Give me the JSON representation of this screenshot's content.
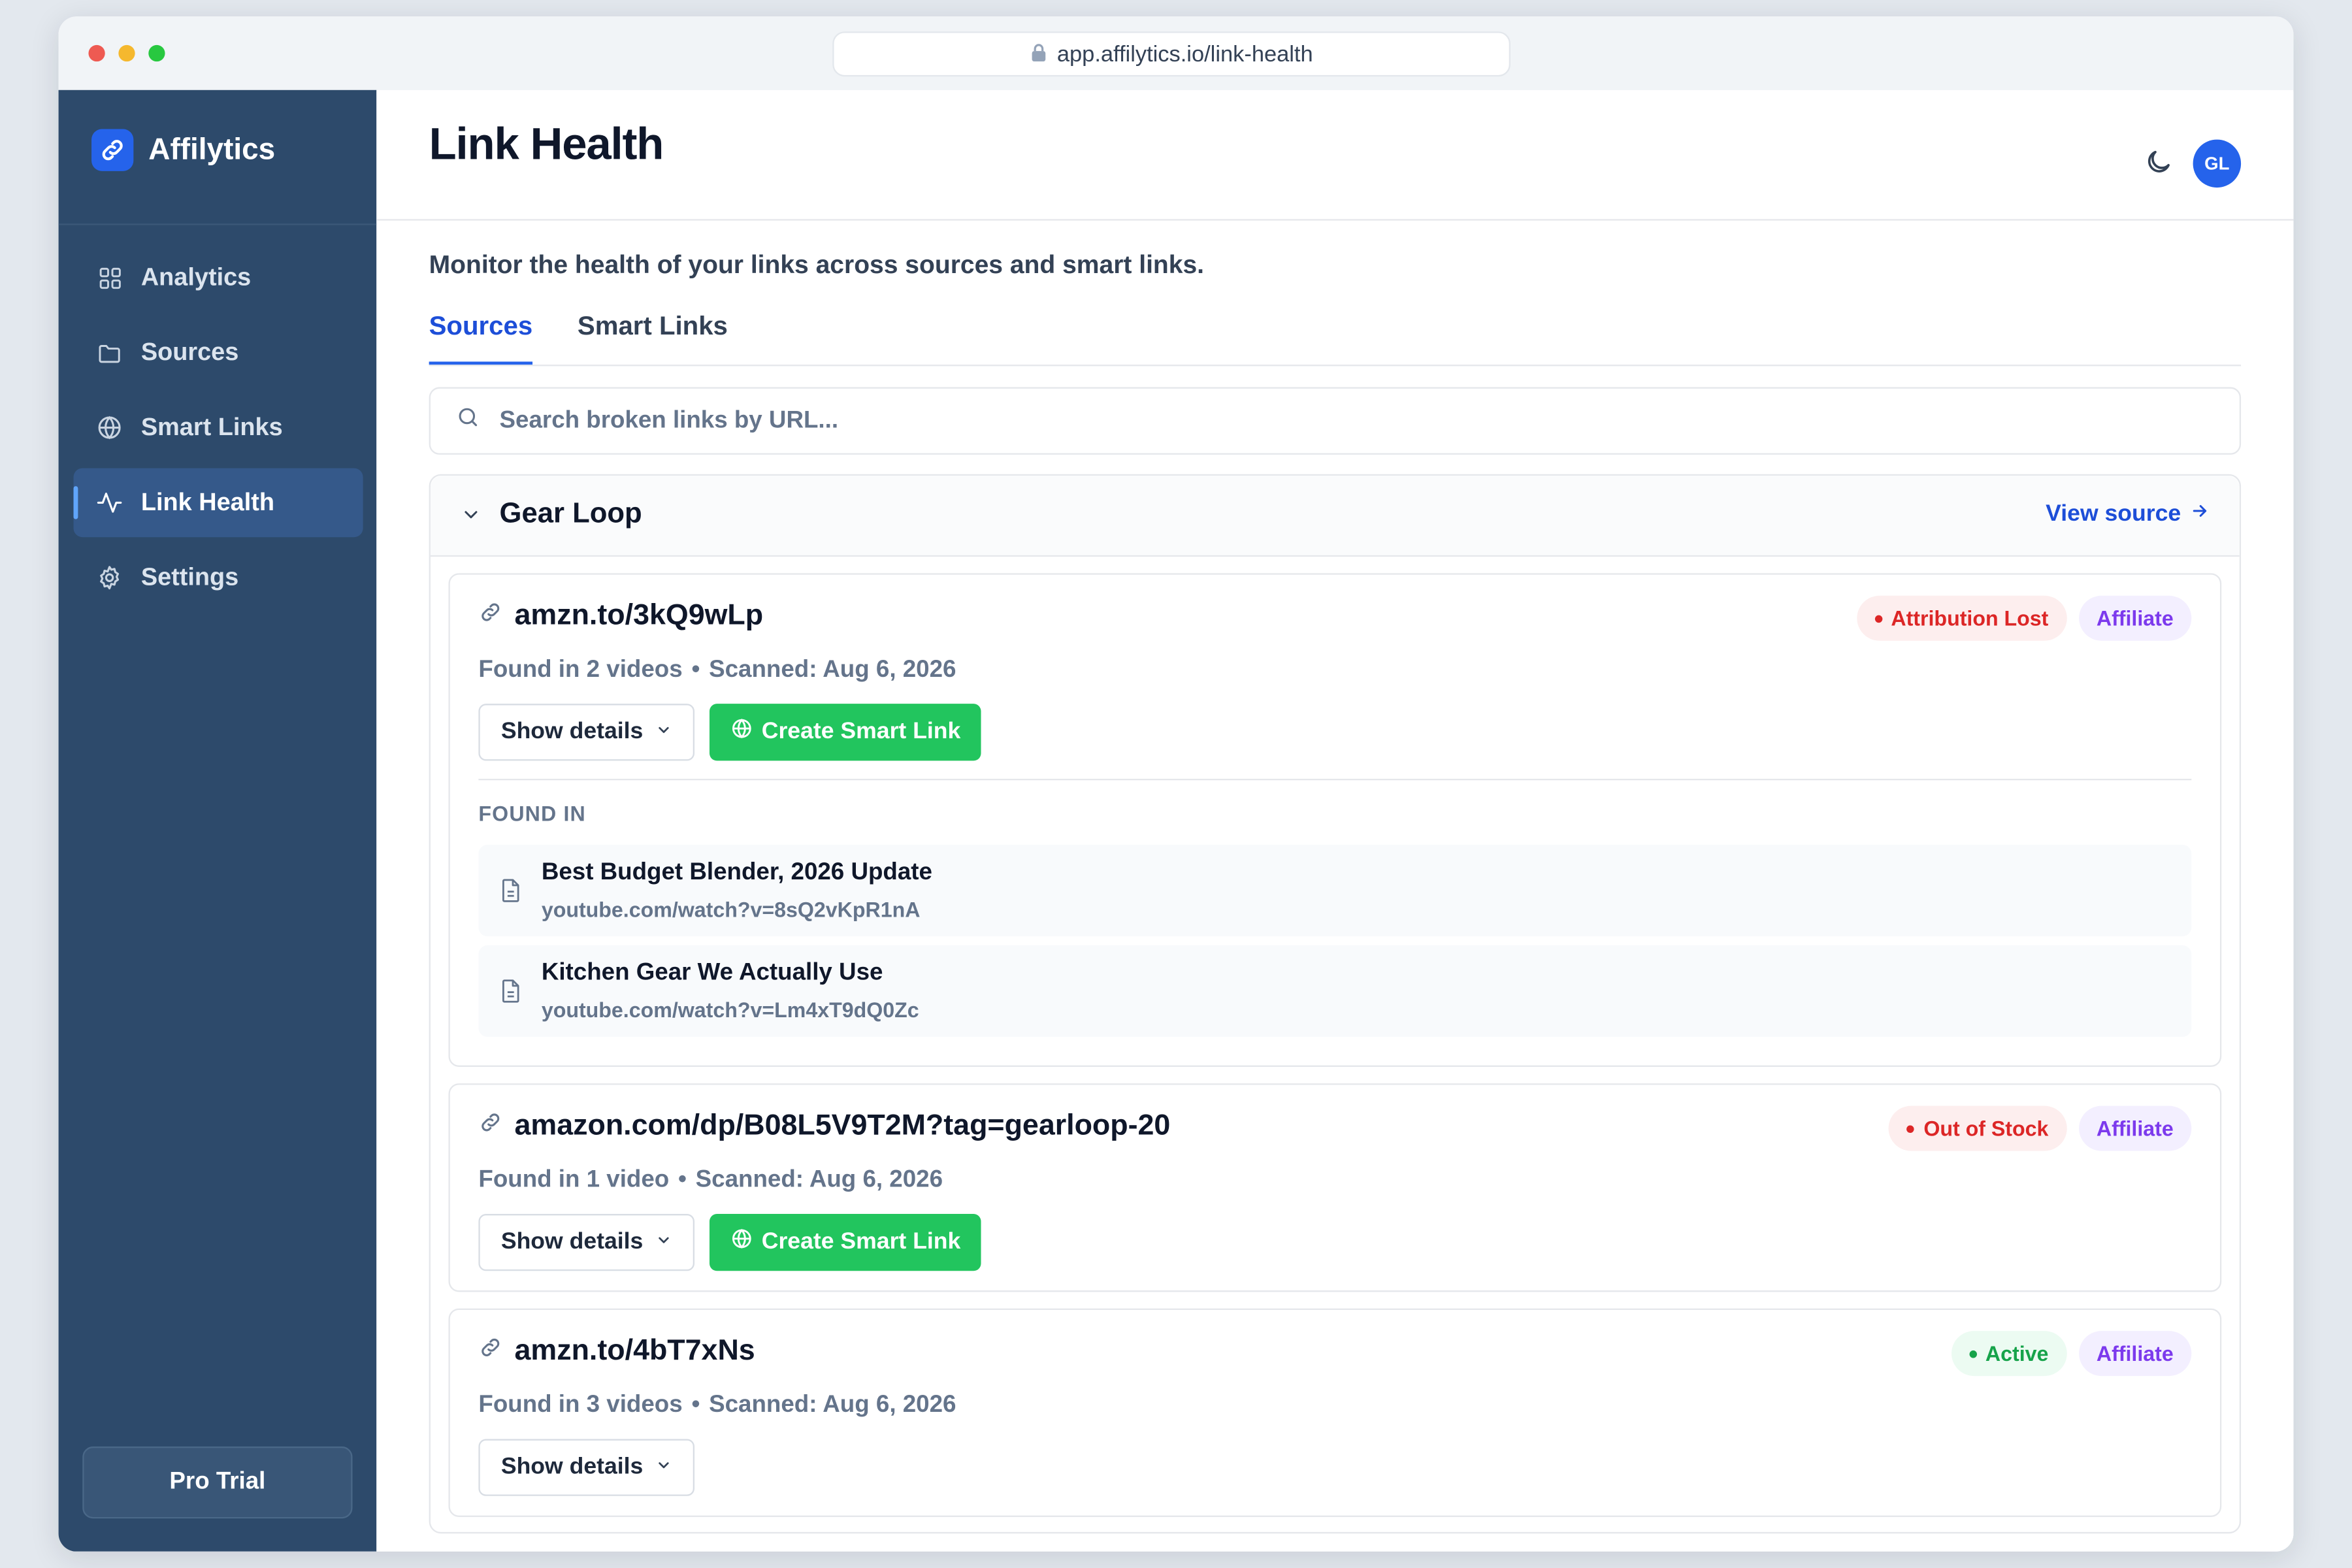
{
  "browser": {
    "url": "app.affilytics.io/link-health",
    "dots": [
      "#ee5a52",
      "#f5b82e",
      "#28c840"
    ]
  },
  "sidebar": {
    "brand": "Affilytics",
    "items": [
      {
        "label": "Analytics",
        "icon": "grid-icon"
      },
      {
        "label": "Sources",
        "icon": "folder-icon"
      },
      {
        "label": "Smart Links",
        "icon": "globe-icon"
      },
      {
        "label": "Link Health",
        "icon": "activity-icon",
        "active": true
      },
      {
        "label": "Settings",
        "icon": "gear-icon"
      }
    ],
    "footer_label": "Pro Trial"
  },
  "header": {
    "title": "Link Health",
    "avatar_initials": "GL"
  },
  "main": {
    "subtitle": "Monitor the health of your links across sources and smart links.",
    "tabs": [
      {
        "label": "Sources",
        "active": true
      },
      {
        "label": "Smart Links",
        "active": false
      }
    ],
    "search": {
      "placeholder": "Search broken links by URL..."
    },
    "group": {
      "name": "Gear Loop",
      "action_label": "View source",
      "cards": [
        {
          "url": "amzn.to/3kQ9wLp",
          "found": "Found in 2 videos",
          "scanned": "Scanned: Aug 6, 2026",
          "status": "Attribution Lost",
          "status_color": "red",
          "type": "Affiliate",
          "details_label": "Show details",
          "create_label": "Create Smart Link",
          "found_in_label": "FOUND IN",
          "found_in": [
            {
              "title": "Best Budget Blender, 2026 Update",
              "url": "youtube.com/watch?v=8sQ2vKpR1nA"
            },
            {
              "title": "Kitchen Gear We Actually Use",
              "url": "youtube.com/watch?v=Lm4xT9dQ0Zc"
            }
          ]
        },
        {
          "url": "amazon.com/dp/B08L5V9T2M?tag=gearloop-20",
          "found": "Found in 1 video",
          "scanned": "Scanned: Aug 6, 2026",
          "status": "Out of Stock",
          "status_color": "red",
          "type": "Affiliate",
          "details_label": "Show details",
          "create_label": "Create Smart Link"
        },
        {
          "url": "amzn.to/4bT7xNs",
          "found": "Found in 3 videos",
          "scanned": "Scanned: Aug 6, 2026",
          "status": "Active",
          "status_color": "green",
          "type": "Affiliate",
          "details_label": "Show details"
        }
      ]
    }
  },
  "colors": {
    "sidebar_bg": "#2d4a6b",
    "accent": "#2563eb",
    "success": "#22c55e",
    "danger": "#dc2626",
    "affiliate": "#7c3aed"
  }
}
